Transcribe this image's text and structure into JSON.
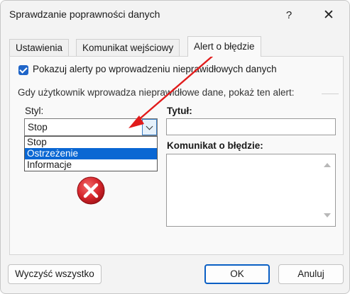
{
  "window": {
    "title": "Sprawdzanie poprawności danych",
    "help_glyph": "?",
    "close_glyph": "✕"
  },
  "tabs": [
    {
      "label": "Ustawienia"
    },
    {
      "label": "Komunikat wejściowy"
    },
    {
      "label": "Alert o błędzie",
      "active": true
    }
  ],
  "options": {
    "show_alerts_label": "Pokazuj alerty po wprowadzeniu nieprawidłowych danych",
    "show_alerts_checked": true,
    "group_label": "Gdy użytkownik wprowadza nieprawidłowe dane, pokaż ten alert:"
  },
  "style": {
    "label": "Styl:",
    "value": "Stop",
    "dropdown_items": [
      "Stop",
      "Ostrzeżenie",
      "Informacje"
    ],
    "highlighted_item": "Ostrzeżenie",
    "icon": "stop-error-icon"
  },
  "title_field": {
    "label": "Tytuł:",
    "value": ""
  },
  "message_field": {
    "label": "Komunikat o błędzie:",
    "value": ""
  },
  "annotation": {
    "arrow_color": "#e11b1b"
  },
  "buttons": {
    "clear_all": "Wyczyść wszystko",
    "ok": "OK",
    "cancel": "Anuluj"
  },
  "colors": {
    "accent": "#1f65c8",
    "selection": "#0a67d3",
    "stop_red": "#d6262c"
  }
}
